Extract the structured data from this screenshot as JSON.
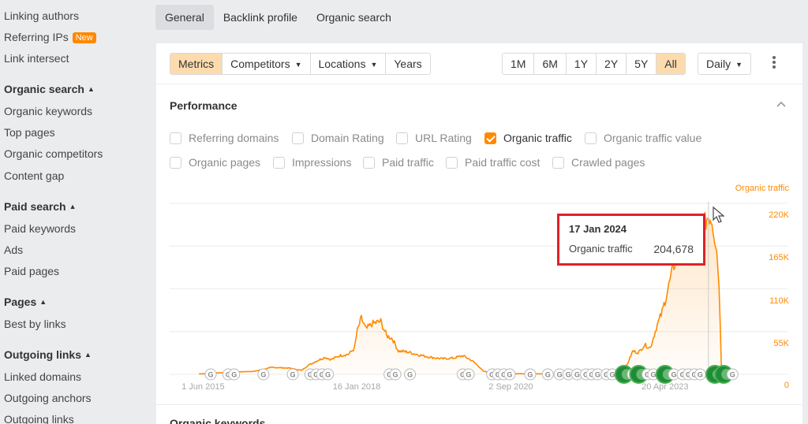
{
  "sidebar": {
    "items": [
      {
        "label": "Linking authors",
        "type": "item"
      },
      {
        "label": "Referring IPs",
        "type": "item",
        "badge": "New"
      },
      {
        "label": "Link intersect",
        "type": "item"
      },
      {
        "label": "Organic search",
        "type": "header"
      },
      {
        "label": "Organic keywords",
        "type": "item"
      },
      {
        "label": "Top pages",
        "type": "item"
      },
      {
        "label": "Organic competitors",
        "type": "item"
      },
      {
        "label": "Content gap",
        "type": "item"
      },
      {
        "label": "Paid search",
        "type": "header"
      },
      {
        "label": "Paid keywords",
        "type": "item"
      },
      {
        "label": "Ads",
        "type": "item"
      },
      {
        "label": "Paid pages",
        "type": "item"
      },
      {
        "label": "Pages",
        "type": "header"
      },
      {
        "label": "Best by links",
        "type": "item"
      },
      {
        "label": "Outgoing links",
        "type": "header"
      },
      {
        "label": "Linked domains",
        "type": "item"
      },
      {
        "label": "Outgoing anchors",
        "type": "item"
      },
      {
        "label": "Outgoing links",
        "type": "item"
      }
    ]
  },
  "tabs": [
    {
      "label": "General",
      "active": true
    },
    {
      "label": "Backlink profile",
      "active": false
    },
    {
      "label": "Organic search",
      "active": false
    }
  ],
  "toolbar": {
    "view_group": [
      {
        "label": "Metrics",
        "active": true,
        "dropdown": false
      },
      {
        "label": "Competitors",
        "active": false,
        "dropdown": true
      },
      {
        "label": "Locations",
        "active": false,
        "dropdown": true
      },
      {
        "label": "Years",
        "active": false,
        "dropdown": false
      }
    ],
    "range_group": [
      {
        "label": "1M",
        "active": false
      },
      {
        "label": "6M",
        "active": false
      },
      {
        "label": "1Y",
        "active": false
      },
      {
        "label": "2Y",
        "active": false
      },
      {
        "label": "5Y",
        "active": false
      },
      {
        "label": "All",
        "active": true
      }
    ],
    "interval": "Daily",
    "more_icon": "kebab-vertical-icon"
  },
  "performance": {
    "title": "Performance",
    "metrics": [
      {
        "label": "Referring domains",
        "checked": false
      },
      {
        "label": "Domain Rating",
        "checked": false
      },
      {
        "label": "URL Rating",
        "checked": false
      },
      {
        "label": "Organic traffic",
        "checked": true
      },
      {
        "label": "Organic traffic value",
        "checked": false
      },
      {
        "label": "Organic pages",
        "checked": false
      },
      {
        "label": "Impressions",
        "checked": false
      },
      {
        "label": "Paid traffic",
        "checked": false
      },
      {
        "label": "Paid traffic cost",
        "checked": false
      },
      {
        "label": "Crawled pages",
        "checked": false
      }
    ]
  },
  "tooltip": {
    "date": "17 Jan 2024",
    "metric": "Organic traffic",
    "value": "204,678"
  },
  "next_section": {
    "title": "Organic keywords"
  },
  "colors": {
    "accent": "#ff8a00",
    "active_segment": "#fcdcae",
    "tooltip_border": "#e0202a",
    "update_marker_green": "#1e8c3a"
  },
  "chart_data": {
    "type": "area",
    "title": "",
    "series": [
      {
        "name": "Organic traffic",
        "color": "#ff8a00",
        "points": [
          [
            2015.35,
            600
          ],
          [
            2015.42,
            800
          ],
          [
            2015.7,
            2000
          ],
          [
            2016.0,
            3000
          ],
          [
            2016.3,
            4000
          ],
          [
            2016.6,
            9000
          ],
          [
            2016.9,
            8000
          ],
          [
            2017.1,
            5000
          ],
          [
            2017.2,
            11000
          ],
          [
            2017.35,
            17000
          ],
          [
            2017.5,
            22000
          ],
          [
            2017.6,
            19000
          ],
          [
            2017.75,
            24000
          ],
          [
            2017.9,
            26000
          ],
          [
            2018.0,
            33000
          ],
          [
            2018.05,
            56000
          ],
          [
            2018.12,
            72000
          ],
          [
            2018.2,
            58000
          ],
          [
            2018.3,
            65000
          ],
          [
            2018.45,
            68000
          ],
          [
            2018.55,
            50000
          ],
          [
            2018.65,
            46000
          ],
          [
            2018.75,
            30000
          ],
          [
            2018.9,
            29000
          ],
          [
            2019.1,
            25000
          ],
          [
            2019.3,
            22000
          ],
          [
            2019.5,
            20000
          ],
          [
            2019.7,
            21000
          ],
          [
            2019.85,
            24000
          ],
          [
            2020.0,
            18000
          ],
          [
            2020.1,
            12000
          ],
          [
            2020.2,
            4000
          ],
          [
            2020.4,
            1500
          ],
          [
            2020.8,
            800
          ],
          [
            2021.3,
            600
          ],
          [
            2021.8,
            500
          ],
          [
            2022.3,
            600
          ],
          [
            2022.55,
            3000
          ],
          [
            2022.65,
            12000
          ],
          [
            2022.75,
            30000
          ],
          [
            2022.85,
            28000
          ],
          [
            2022.95,
            38000
          ],
          [
            2023.05,
            34000
          ],
          [
            2023.15,
            60000
          ],
          [
            2023.25,
            80000
          ],
          [
            2023.35,
            110000
          ],
          [
            2023.45,
            140000
          ],
          [
            2023.55,
            160000
          ],
          [
            2023.65,
            170000
          ],
          [
            2023.75,
            168000
          ],
          [
            2023.85,
            172000
          ],
          [
            2023.95,
            190000
          ],
          [
            2024.04,
            204678
          ],
          [
            2024.1,
            200000
          ],
          [
            2024.18,
            160000
          ],
          [
            2024.22,
            120000
          ],
          [
            2024.26,
            10000
          ],
          [
            2024.3,
            800
          ],
          [
            2024.5,
            600
          ]
        ]
      }
    ],
    "xlabel": "",
    "ylabel": "Organic traffic",
    "x_ticks": [
      {
        "value": 2015.42,
        "label": "1 Jun 2015"
      },
      {
        "value": 2018.04,
        "label": "16 Jan 2018"
      },
      {
        "value": 2020.67,
        "label": "2 Sep 2020"
      },
      {
        "value": 2023.3,
        "label": "20 Apr 2023"
      }
    ],
    "y_ticks": [
      {
        "value": 0,
        "label": "0"
      },
      {
        "value": 55000,
        "label": "55K"
      },
      {
        "value": 110000,
        "label": "110K"
      },
      {
        "value": 165000,
        "label": "165K"
      },
      {
        "value": 220000,
        "label": "220K"
      }
    ],
    "xlim": [
      2014.85,
      2024.85
    ],
    "ylim": [
      0,
      220000
    ],
    "grid": true,
    "axis_title_position": "top-right",
    "hover": {
      "x": 2024.04,
      "label": "17 Jan 2024",
      "value": 204678
    },
    "update_markers": [
      {
        "x": 2015.55,
        "major": false
      },
      {
        "x": 2015.85,
        "major": false
      },
      {
        "x": 2015.95,
        "major": false
      },
      {
        "x": 2016.45,
        "major": false
      },
      {
        "x": 2016.95,
        "major": false
      },
      {
        "x": 2017.25,
        "major": false
      },
      {
        "x": 2017.35,
        "major": false
      },
      {
        "x": 2017.45,
        "major": false
      },
      {
        "x": 2017.55,
        "major": false
      },
      {
        "x": 2018.6,
        "major": false
      },
      {
        "x": 2018.7,
        "major": false
      },
      {
        "x": 2018.95,
        "major": false
      },
      {
        "x": 2019.85,
        "major": false
      },
      {
        "x": 2019.95,
        "major": false
      },
      {
        "x": 2020.35,
        "major": false
      },
      {
        "x": 2020.45,
        "major": false
      },
      {
        "x": 2020.55,
        "major": false
      },
      {
        "x": 2020.65,
        "major": false
      },
      {
        "x": 2021.0,
        "major": false
      },
      {
        "x": 2021.3,
        "major": false
      },
      {
        "x": 2021.5,
        "major": false
      },
      {
        "x": 2021.65,
        "major": false
      },
      {
        "x": 2021.8,
        "major": false
      },
      {
        "x": 2021.95,
        "major": false
      },
      {
        "x": 2022.05,
        "major": false
      },
      {
        "x": 2022.15,
        "major": false
      },
      {
        "x": 2022.3,
        "major": false
      },
      {
        "x": 2022.4,
        "major": false
      },
      {
        "x": 2022.6,
        "major": true
      },
      {
        "x": 2022.75,
        "major": false
      },
      {
        "x": 2022.85,
        "major": true
      },
      {
        "x": 2023.0,
        "major": false
      },
      {
        "x": 2023.1,
        "major": false
      },
      {
        "x": 2023.3,
        "major": true
      },
      {
        "x": 2023.45,
        "major": false
      },
      {
        "x": 2023.6,
        "major": false
      },
      {
        "x": 2023.7,
        "major": false
      },
      {
        "x": 2023.8,
        "major": false
      },
      {
        "x": 2023.9,
        "major": false
      },
      {
        "x": 2024.15,
        "major": true
      },
      {
        "x": 2024.3,
        "major": true
      },
      {
        "x": 2024.45,
        "major": false
      }
    ]
  }
}
